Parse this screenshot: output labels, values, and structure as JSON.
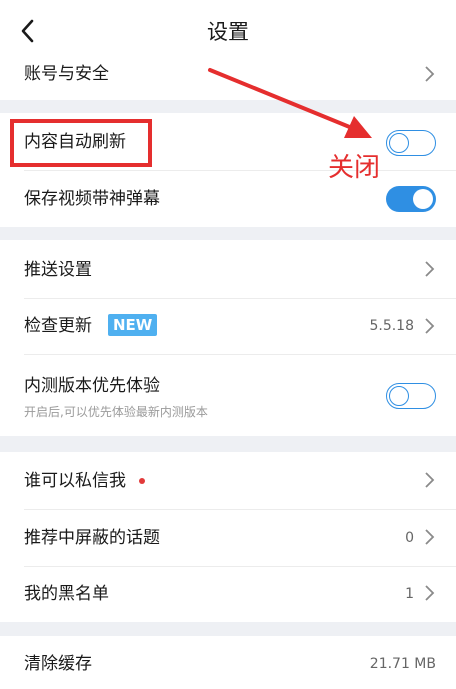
{
  "header": {
    "title": "设置"
  },
  "section1": {
    "account_label": "账号与安全"
  },
  "section2": {
    "auto_refresh_label": "内容自动刷新",
    "auto_refresh_on": false,
    "save_barrage_label": "保存视频带神弹幕",
    "save_barrage_on": true
  },
  "section3": {
    "push_label": "推送设置",
    "check_update_label": "检查更新",
    "new_badge": "NEW",
    "version": "5.5.18",
    "beta_label": "内测版本优先体验",
    "beta_sublabel": "开启后,可以优先体验最新内测版本",
    "beta_on": false
  },
  "section4": {
    "private_msg_label": "谁可以私信我",
    "blocked_topics_label": "推荐中屏蔽的话题",
    "blocked_topics_count": "0",
    "blacklist_label": "我的黑名单",
    "blacklist_count": "1"
  },
  "section5": {
    "clear_cache_label": "清除缓存",
    "cache_size": "21.71 MB"
  },
  "annotation": {
    "text": "关闭"
  },
  "colors": {
    "accent": "#2f8fe3",
    "annotation_red": "#e52e2e",
    "badge_blue": "#4fb0f0",
    "background": "#eef0f4"
  }
}
